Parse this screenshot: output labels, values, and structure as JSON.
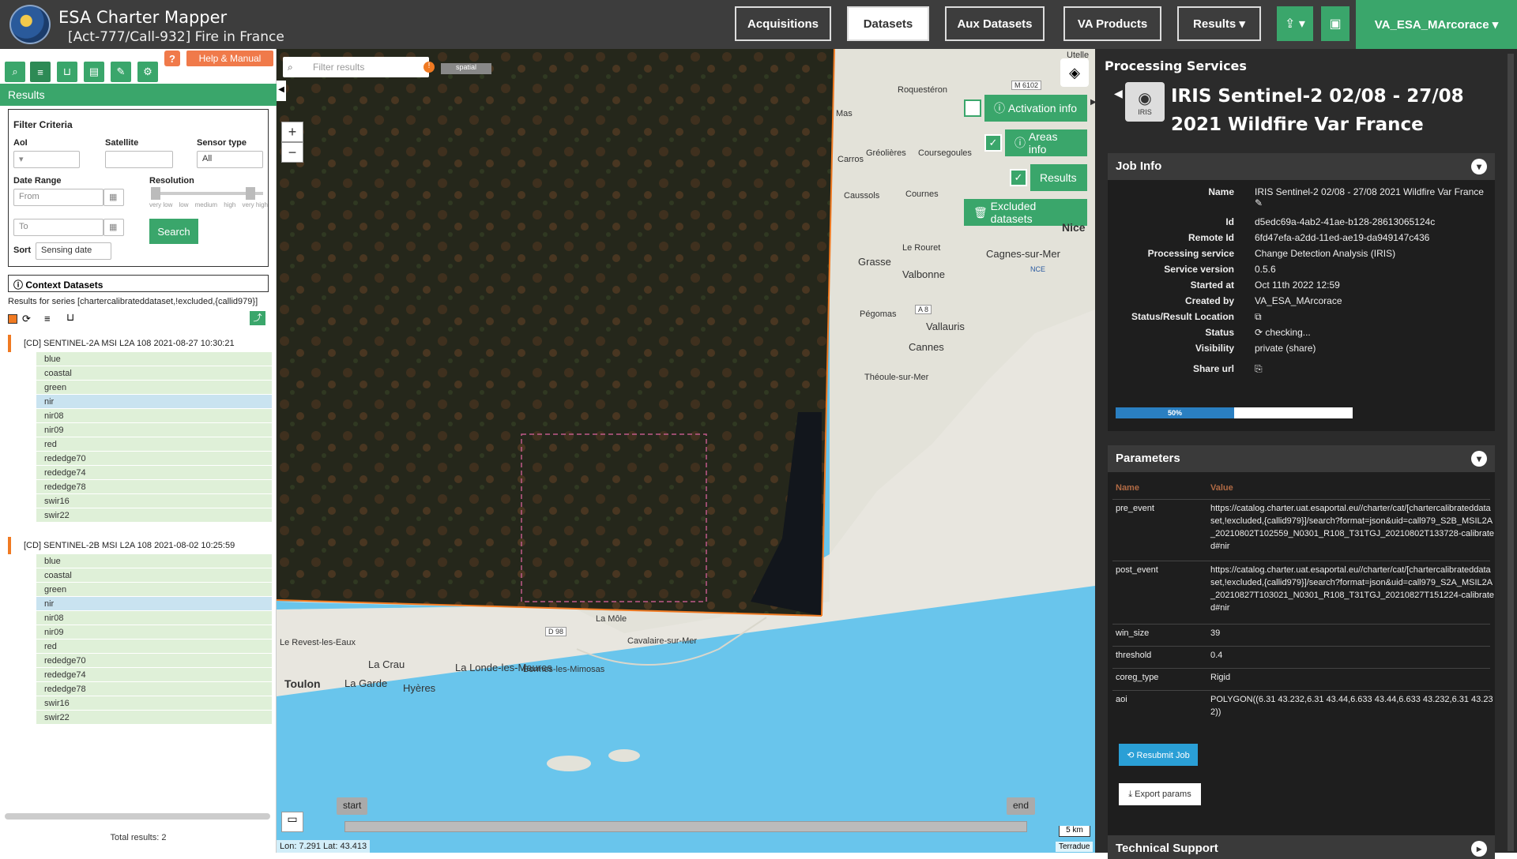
{
  "header": {
    "app_title": "ESA Charter Mapper",
    "subtitle": "[Act-777/Call-932] Fire in France",
    "nav": [
      "Acquisitions",
      "Datasets",
      "Aux Datasets",
      "VA Products",
      "Results ▾"
    ],
    "active_nav": "Datasets",
    "user": "VA_ESA_MArcorace ▾"
  },
  "left": {
    "help_label": "Help & Manual",
    "results_title": "Results",
    "filter": {
      "title": "Filter Criteria",
      "aoi": "AoI",
      "satellite": "Satellite",
      "sensor_type": "Sensor type",
      "sensor_value": "All",
      "date_range": "Date Range",
      "from_placeholder": "From",
      "to_placeholder": "To",
      "resolution": "Resolution",
      "res_ticks": [
        "very low",
        "low",
        "medium",
        "high",
        "very high"
      ],
      "search": "Search",
      "sort": "Sort",
      "sort_value": "Sensing date"
    },
    "context_title": "Context Datasets",
    "results_for": "Results for series [chartercalibrateddataset,!excluded,{callid979}]",
    "datasets": [
      {
        "title": "[CD] SENTINEL-2A MSI L2A 108 2021-08-27 10:30:21",
        "bands": [
          "blue",
          "coastal",
          "green",
          "nir",
          "nir08",
          "nir09",
          "red",
          "rededge70",
          "rededge74",
          "rededge78",
          "swir16",
          "swir22"
        ]
      },
      {
        "title": "[CD] SENTINEL-2B MSI L2A 108 2021-08-02 10:25:59",
        "bands": [
          "blue",
          "coastal",
          "green",
          "nir",
          "nir08",
          "nir09",
          "red",
          "rededge70",
          "rededge74",
          "rededge78",
          "swir16",
          "swir22"
        ]
      }
    ],
    "selected_band": "nir",
    "total": "Total results: 2"
  },
  "map": {
    "filter_placeholder": "Filter results",
    "spatial_tag": "spatial",
    "activation_info": "Activation info",
    "areas_info": "Areas info",
    "results": "Results",
    "excluded": "Excluded datasets",
    "labels": [
      "Utelle",
      "Roquestéron",
      "Gréolières",
      "Coursegoules",
      "Caussols",
      "Cournes",
      "Nice",
      "Grasse",
      "Le Rouret",
      "Cagnes-sur-Mer",
      "Valbonne",
      "Vallauris",
      "Pégomas",
      "Cannes",
      "Théoule-sur-Mer",
      "La Môle",
      "Cavalaire-sur-Mer",
      "Le Revest-les-Eaux",
      "La Crau",
      "La Londe-les-Maures",
      "Bormes-les-Mimosas",
      "Toulon",
      "La Garde",
      "Hyères",
      "Carros",
      "Mas",
      "M 6102",
      "A 8",
      "D 98",
      "NCE"
    ],
    "start": "start",
    "end": "end",
    "scale": "5 km",
    "attribution": "Terradue",
    "coords": "Lon: 7.291 Lat: 43.413"
  },
  "right": {
    "title": "Processing Services",
    "job_title": "IRIS Sentinel-2 02/08 - 27/08 2021 Wildfire Var France",
    "icon_label": "IRIS",
    "job_info": "Job Info",
    "fields": [
      {
        "k": "Name",
        "v": "IRIS Sentinel-2 02/08 - 27/08 2021 Wildfire Var France ✎"
      },
      {
        "k": "Id",
        "v": "d5edc69a-4ab2-41ae-b128-28613065124c"
      },
      {
        "k": "Remote Id",
        "v": "6fd47efa-a2dd-11ed-ae19-da949147c436"
      },
      {
        "k": "Processing service",
        "v": "Change Detection Analysis (IRIS)"
      },
      {
        "k": "Service version",
        "v": "0.5.6"
      },
      {
        "k": "Started at",
        "v": "Oct 11th 2022 12:59"
      },
      {
        "k": "Created by",
        "v": "VA_ESA_MArcorace"
      },
      {
        "k": "Status/Result Location",
        "v": "⧉"
      },
      {
        "k": "Status",
        "v": "⟳ checking..."
      },
      {
        "k": "Visibility",
        "v": "private (share)"
      },
      {
        "k": "Share url",
        "v": "⎘"
      }
    ],
    "progress": 0.5,
    "progress_label": "50%",
    "parameters": "Parameters",
    "param_name_hdr": "Name",
    "param_value_hdr": "Value",
    "params": [
      {
        "k": "pre_event",
        "v": "https://catalog.charter.uat.esaportal.eu//charter/cat/[chartercalibrateddataset,!excluded,{callid979}]/search?format=json&uid=call979_S2B_MSIL2A_20210802T102559_N0301_R108_T31TGJ_20210802T133728-calibrated#nir"
      },
      {
        "k": "post_event",
        "v": "https://catalog.charter.uat.esaportal.eu//charter/cat/[chartercalibrateddataset,!excluded,{callid979}]/search?format=json&uid=call979_S2A_MSIL2A_20210827T103021_N0301_R108_T31TGJ_20210827T151224-calibrated#nir"
      },
      {
        "k": "win_size",
        "v": "39"
      },
      {
        "k": "threshold",
        "v": "0.4"
      },
      {
        "k": "coreg_type",
        "v": "Rigid"
      },
      {
        "k": "aoi",
        "v": "POLYGON((6.31 43.232,6.31 43.44,6.633 43.44,6.633 43.232,6.31 43.232))"
      }
    ],
    "resubmit": "⟲ Resubmit Job",
    "export": "⤓ Export params",
    "tech_support": "Technical Support"
  }
}
